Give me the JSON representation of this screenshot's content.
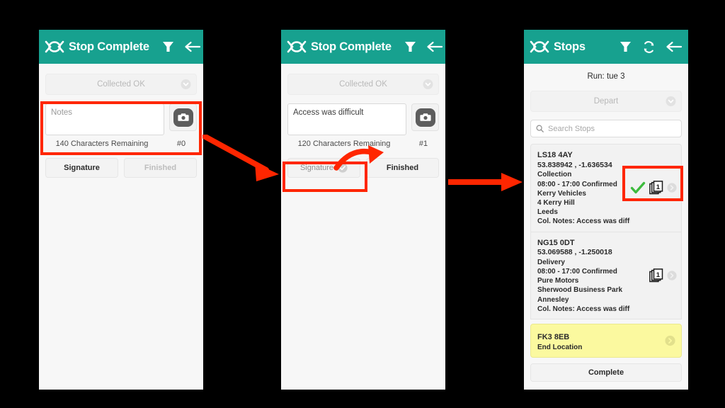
{
  "panels": {
    "stop_complete_empty": {
      "appbar": {
        "title": "Stop Complete",
        "logo_icon": "route-loop-logo-icon",
        "filter_icon": "filter-funnel-icon",
        "back_icon": "back-arrow-icon"
      },
      "status_dropdown": {
        "label": "Collected OK",
        "chevron_icon": "chevron-down-circle-icon"
      },
      "notes": {
        "value": "",
        "placeholder": "Notes"
      },
      "camera_icon": "camera-icon",
      "characters_remaining": "140 Characters Remaining",
      "photo_count": "#0",
      "buttons": {
        "signature": "Signature",
        "finished": "Finished"
      }
    },
    "stop_complete_filled": {
      "appbar": {
        "title": "Stop Complete",
        "logo_icon": "route-loop-logo-icon",
        "filter_icon": "filter-funnel-icon",
        "back_icon": "back-arrow-icon"
      },
      "status_dropdown": {
        "label": "Collected OK",
        "chevron_icon": "chevron-down-circle-icon"
      },
      "notes": {
        "value": "Access was difficult",
        "placeholder": "Notes"
      },
      "camera_icon": "camera-icon",
      "characters_remaining": "120 Characters Remaining",
      "photo_count": "#1",
      "buttons": {
        "signature": "Signature",
        "finished": "Finished",
        "signature_done_icon": "check-circle-icon"
      }
    },
    "stops_list": {
      "appbar": {
        "title": "Stops",
        "logo_icon": "route-loop-logo-icon",
        "filter_icon": "filter-funnel-icon",
        "refresh_icon": "refresh-icon",
        "back_icon": "back-arrow-icon"
      },
      "run_label": "Run: tue 3",
      "depart": {
        "label": "Depart",
        "chevron_icon": "chevron-down-circle-icon"
      },
      "search": {
        "placeholder": "Search Stops",
        "icon": "search-icon"
      },
      "stops": [
        {
          "code": "LS18 4AY",
          "coords": "53.838942 , -1.636534",
          "type": "Collection",
          "window": "08:00 - 17:00 Confirmed",
          "company": "Kerry Vehicles",
          "address1": "4 Kerry Hill",
          "address2": "Leeds",
          "notes": "Col. Notes: Access was diffic",
          "completed": true,
          "check_icon": "green-check-icon",
          "docs_icon": "documents-stack-icon",
          "docs_count": "1",
          "chevron_icon": "chevron-right-circle-icon"
        },
        {
          "code": "NG15 0DT",
          "coords": "53.069588 , -1.250018",
          "type": "Delivery",
          "window": "08:00 - 17:00 Confirmed",
          "company": "Pure Motors",
          "address1": "Sherwood Business Park",
          "address2": "Annesley",
          "notes": "Col. Notes: Access was diffic",
          "completed": false,
          "docs_icon": "documents-stack-icon",
          "docs_count": "1",
          "chevron_icon": "chevron-right-circle-icon"
        }
      ],
      "end_location": {
        "code": "FK3 8EB",
        "label": "End Location",
        "chevron_icon": "chevron-right-circle-icon"
      },
      "complete_button": "Complete"
    }
  },
  "annotations": {
    "highlight_color": "#ff2600",
    "arrow_1": "arrow-panel1-to-panel2",
    "arrow_2": "arrow-signature-to-finished",
    "arrow_3": "arrow-panel2-to-panel3"
  },
  "theme": {
    "brand_teal": "#17a18f",
    "end_location_yellow": "#fbf99f",
    "check_green": "#3dbb3d",
    "background": "#000000"
  }
}
